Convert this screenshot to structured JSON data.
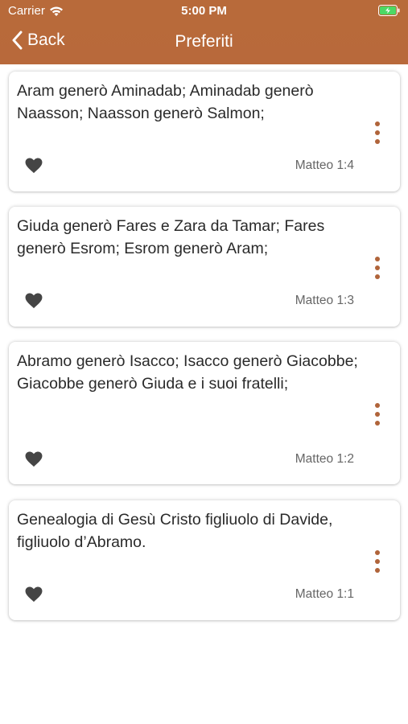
{
  "status_bar": {
    "carrier": "Carrier",
    "time": "5:00 PM"
  },
  "nav": {
    "back_label": "Back",
    "title": "Preferiti"
  },
  "colors": {
    "header": "#b86a3a",
    "accent": "#b0643a",
    "battery": "#4cd964"
  },
  "favorites": [
    {
      "text": "Aram generò Aminadab; Aminadab generò Naasson; Naasson generò Salmon;",
      "reference": "Matteo 1:4"
    },
    {
      "text": "Giuda generò Fares e Zara da Tamar; Fares generò Esrom; Esrom generò Aram;",
      "reference": "Matteo 1:3"
    },
    {
      "text": "Abramo generò Isacco; Isacco generò Giacobbe; Giacobbe generò Giuda e i suoi fratelli;",
      "reference": "Matteo 1:2"
    },
    {
      "text": "Genealogia di Gesù Cristo figliuolo di Davide, figliuolo d’Abramo.",
      "reference": "Matteo 1:1"
    }
  ]
}
